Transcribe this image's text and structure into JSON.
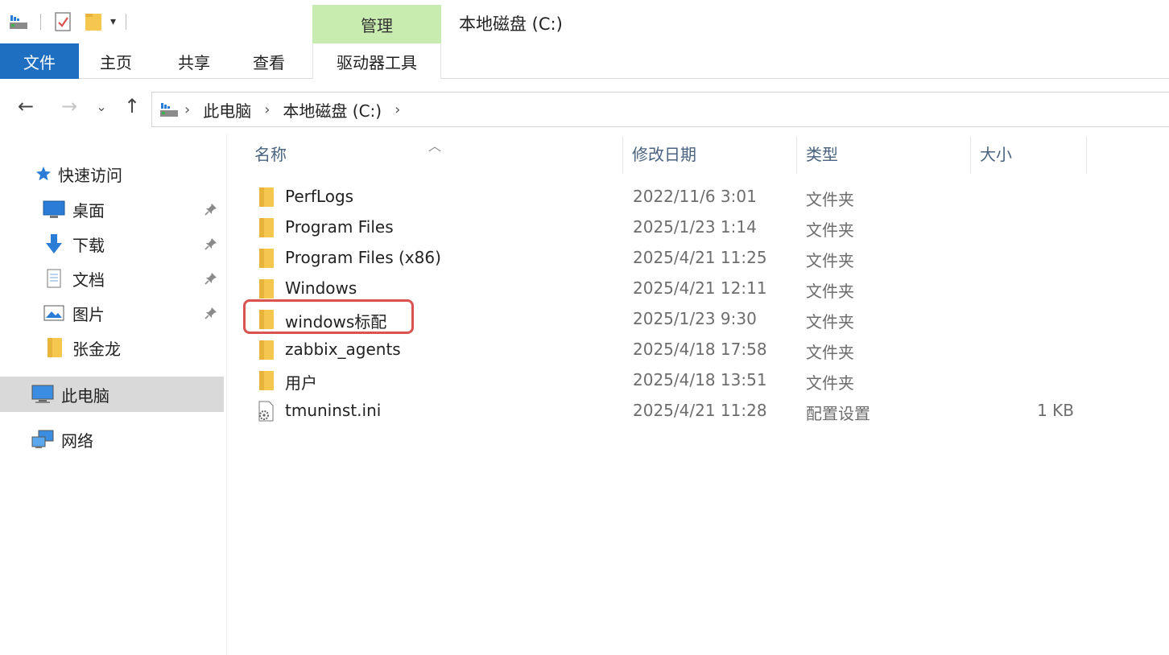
{
  "window": {
    "title": "本地磁盘 (C:)",
    "context_tab_header": "管理"
  },
  "ribbon": {
    "tabs": [
      {
        "label": "文件"
      },
      {
        "label": "主页"
      },
      {
        "label": "共享"
      },
      {
        "label": "查看"
      },
      {
        "label": "驱动器工具"
      }
    ]
  },
  "address": {
    "path": [
      "此电脑",
      "本地磁盘 (C:)"
    ]
  },
  "nav_pane": {
    "quick_access": "快速访问",
    "pinned": [
      {
        "label": "桌面",
        "icon": "desktop-icon"
      },
      {
        "label": "下载",
        "icon": "download-icon"
      },
      {
        "label": "文档",
        "icon": "document-icon"
      },
      {
        "label": "图片",
        "icon": "pictures-icon"
      }
    ],
    "folder": "张金龙",
    "this_pc": "此电脑",
    "network": "网络"
  },
  "columns": {
    "name": "名称",
    "date": "修改日期",
    "type": "类型",
    "size": "大小"
  },
  "files": [
    {
      "name": "PerfLogs",
      "date": "2022/11/6 3:01",
      "type": "文件夹",
      "size": "",
      "icon": "folder-icon"
    },
    {
      "name": "Program Files",
      "date": "2025/1/23 1:14",
      "type": "文件夹",
      "size": "",
      "icon": "folder-icon"
    },
    {
      "name": "Program Files (x86)",
      "date": "2025/4/21 11:25",
      "type": "文件夹",
      "size": "",
      "icon": "folder-icon"
    },
    {
      "name": "Windows",
      "date": "2025/4/21 12:11",
      "type": "文件夹",
      "size": "",
      "icon": "folder-icon"
    },
    {
      "name": "windows标配",
      "date": "2025/1/23 9:30",
      "type": "文件夹",
      "size": "",
      "icon": "folder-icon"
    },
    {
      "name": "zabbix_agents",
      "date": "2025/4/18 17:58",
      "type": "文件夹",
      "size": "",
      "icon": "folder-icon"
    },
    {
      "name": "用户",
      "date": "2025/4/18 13:51",
      "type": "文件夹",
      "size": "",
      "icon": "folder-icon"
    },
    {
      "name": "tmuninst.ini",
      "date": "2025/4/21 11:28",
      "type": "配置设置",
      "size": "1 KB",
      "icon": "settings-file-icon"
    }
  ],
  "colors": {
    "file_tab": "#1e6fc2",
    "context_tab": "#c8ecb0",
    "folder": "#f5c74e",
    "highlight": "#d9534f",
    "header_text": "#4a6380"
  }
}
